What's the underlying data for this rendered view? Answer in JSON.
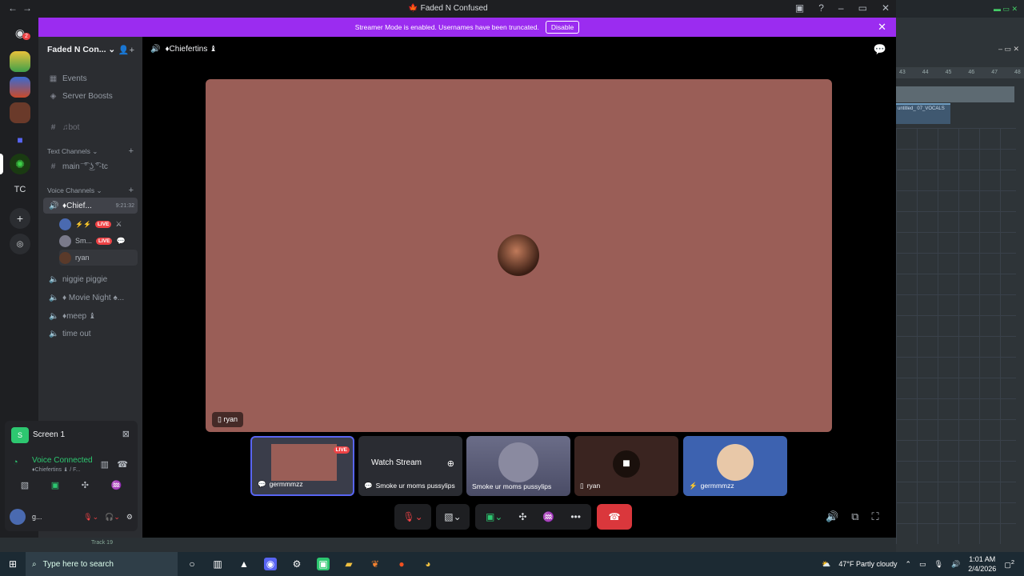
{
  "window": {
    "title": "Faded N Confused"
  },
  "banner": {
    "text": "Streamer Mode is enabled. Usernames have been truncated.",
    "disable_label": "Disable"
  },
  "server": {
    "name": "Faded N Con...",
    "active_badge": "2",
    "tc_label": "TC"
  },
  "sidebar": {
    "events": "Events",
    "boosts": "Server Boosts",
    "bot": "♫bot",
    "text_category": "Text Channels",
    "main_channel": "main ̈ ͡° ͜ʖ ͡°-tc",
    "voice_category": "Voice Channels",
    "active_voice": "♦Chief...",
    "active_timer": "9:21:32",
    "voice_users": [
      {
        "name": "",
        "live": "LIVE"
      },
      {
        "name": "Sm...",
        "live": "LIVE"
      },
      {
        "name": "ryan",
        "live": ""
      }
    ],
    "voice_channels": [
      "niggie piggie",
      "♦ Movie Night ♠...",
      "♦meep ♝",
      "time out"
    ]
  },
  "panel": {
    "screen_label": "Screen 1",
    "voice_connected": "Voice Connected",
    "voice_sub": "♦Chiefertins ♝ / F...",
    "user_name": "g..."
  },
  "main": {
    "channel_header": "♦Chiefertins ♝",
    "stage_tag": "ryan",
    "tiles": [
      {
        "label": "germmmzz",
        "badge": "LIVE"
      },
      {
        "label": "Smoke ur moms pussylips",
        "watch": "Watch Stream"
      },
      {
        "label": "Smoke ur moms pussylips"
      },
      {
        "label": "ryan"
      },
      {
        "label": "germmmzz"
      }
    ]
  },
  "daw": {
    "track": "Track 19",
    "clip": "untitled_ 07_VOCALS",
    "ruler": [
      "43",
      "44",
      "45",
      "46",
      "47",
      "48"
    ]
  },
  "taskbar": {
    "search_placeholder": "Type here to search",
    "weather": "47°F  Partly cloudy",
    "time": "1:01 AM",
    "date": "2/4/2026",
    "notif": "2"
  }
}
